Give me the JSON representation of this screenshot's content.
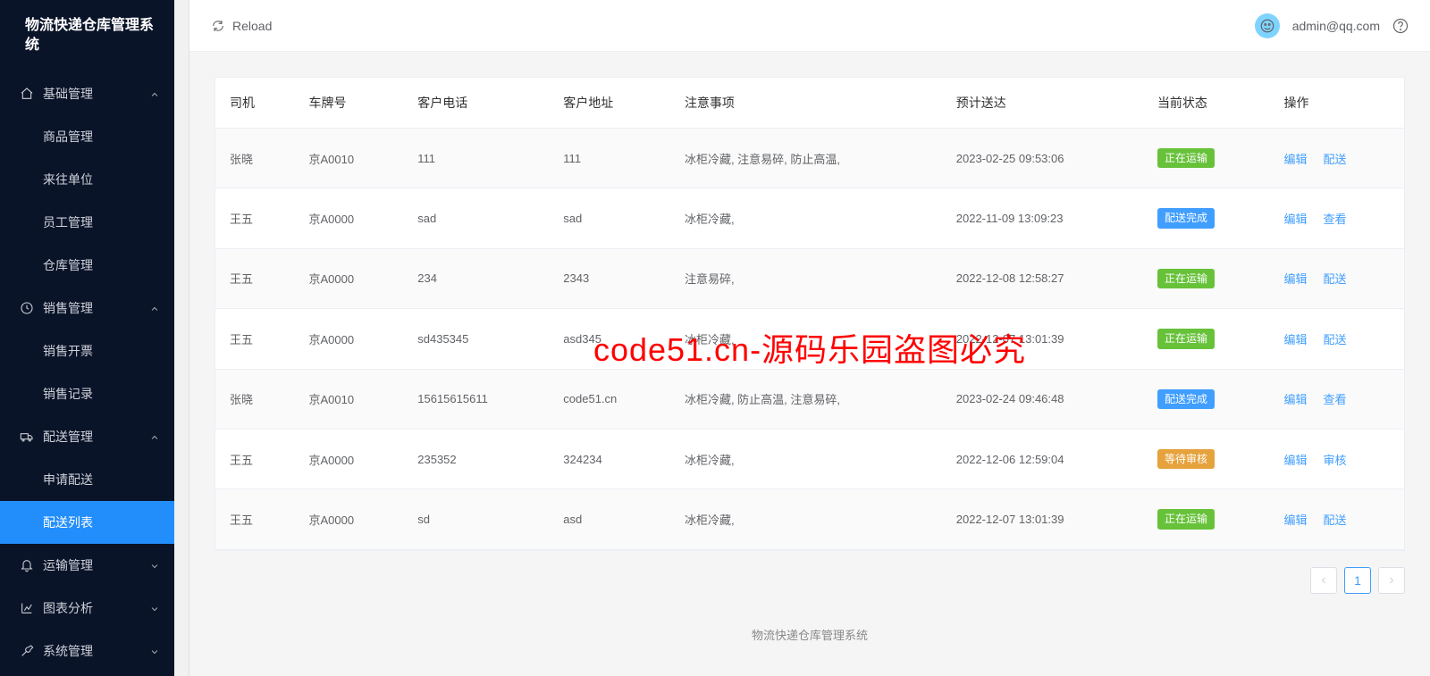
{
  "app_title": "物流快递仓库管理系统",
  "sidebar": {
    "groups": [
      {
        "label": "基础管理",
        "icon": "home",
        "expanded": true,
        "items": [
          {
            "label": "商品管理"
          },
          {
            "label": "来往单位"
          },
          {
            "label": "员工管理"
          },
          {
            "label": "仓库管理"
          }
        ]
      },
      {
        "label": "销售管理",
        "icon": "clock",
        "expanded": true,
        "items": [
          {
            "label": "销售开票"
          },
          {
            "label": "销售记录"
          }
        ]
      },
      {
        "label": "配送管理",
        "icon": "truck",
        "expanded": true,
        "items": [
          {
            "label": "申请配送"
          },
          {
            "label": "配送列表",
            "active": true
          }
        ]
      },
      {
        "label": "运输管理",
        "icon": "bell",
        "expanded": false,
        "items": []
      },
      {
        "label": "图表分析",
        "icon": "chart",
        "expanded": false,
        "items": []
      },
      {
        "label": "系统管理",
        "icon": "wrench",
        "expanded": false,
        "items": []
      }
    ]
  },
  "topbar": {
    "reload_label": "Reload",
    "user_email": "admin@qq.com"
  },
  "table": {
    "headers": [
      "司机",
      "车牌号",
      "客户电话",
      "客户地址",
      "注意事项",
      "预计送达",
      "当前状态",
      "操作"
    ],
    "rows": [
      {
        "driver": "张晓",
        "plate": "京A0010",
        "phone": "111",
        "address": "111",
        "notes": "冰柜冷藏, 注意易碎, 防止高温,",
        "eta": "2023-02-25 09:53:06",
        "status": "正在运输",
        "status_color": "green",
        "actions": [
          "编辑",
          "配送"
        ]
      },
      {
        "driver": "王五",
        "plate": "京A0000",
        "phone": "sad",
        "address": "sad",
        "notes": "冰柜冷藏,",
        "eta": "2022-11-09 13:09:23",
        "status": "配送完成",
        "status_color": "blue",
        "actions": [
          "编辑",
          "查看"
        ]
      },
      {
        "driver": "王五",
        "plate": "京A0000",
        "phone": "234",
        "address": "2343",
        "notes": "注意易碎,",
        "eta": "2022-12-08 12:58:27",
        "status": "正在运输",
        "status_color": "green",
        "actions": [
          "编辑",
          "配送"
        ]
      },
      {
        "driver": "王五",
        "plate": "京A0000",
        "phone": "sd435345",
        "address": "asd345",
        "notes": "冰柜冷藏,",
        "eta": "2022-12-07 13:01:39",
        "status": "正在运输",
        "status_color": "green",
        "actions": [
          "编辑",
          "配送"
        ]
      },
      {
        "driver": "张晓",
        "plate": "京A0010",
        "phone": "15615615611",
        "address": "code51.cn",
        "notes": "冰柜冷藏, 防止高温, 注意易碎,",
        "eta": "2023-02-24 09:46:48",
        "status": "配送完成",
        "status_color": "blue",
        "actions": [
          "编辑",
          "查看"
        ]
      },
      {
        "driver": "王五",
        "plate": "京A0000",
        "phone": "235352",
        "address": "324234",
        "notes": "冰柜冷藏,",
        "eta": "2022-12-06 12:59:04",
        "status": "等待审核",
        "status_color": "orange",
        "actions": [
          "编辑",
          "审核"
        ]
      },
      {
        "driver": "王五",
        "plate": "京A0000",
        "phone": "sd",
        "address": "asd",
        "notes": "冰柜冷藏,",
        "eta": "2022-12-07 13:01:39",
        "status": "正在运输",
        "status_color": "green",
        "actions": [
          "编辑",
          "配送"
        ]
      }
    ]
  },
  "pagination": {
    "current": "1"
  },
  "footer_text": "物流快递仓库管理系统",
  "watermark": "code51.cn-源码乐园盗图必究"
}
